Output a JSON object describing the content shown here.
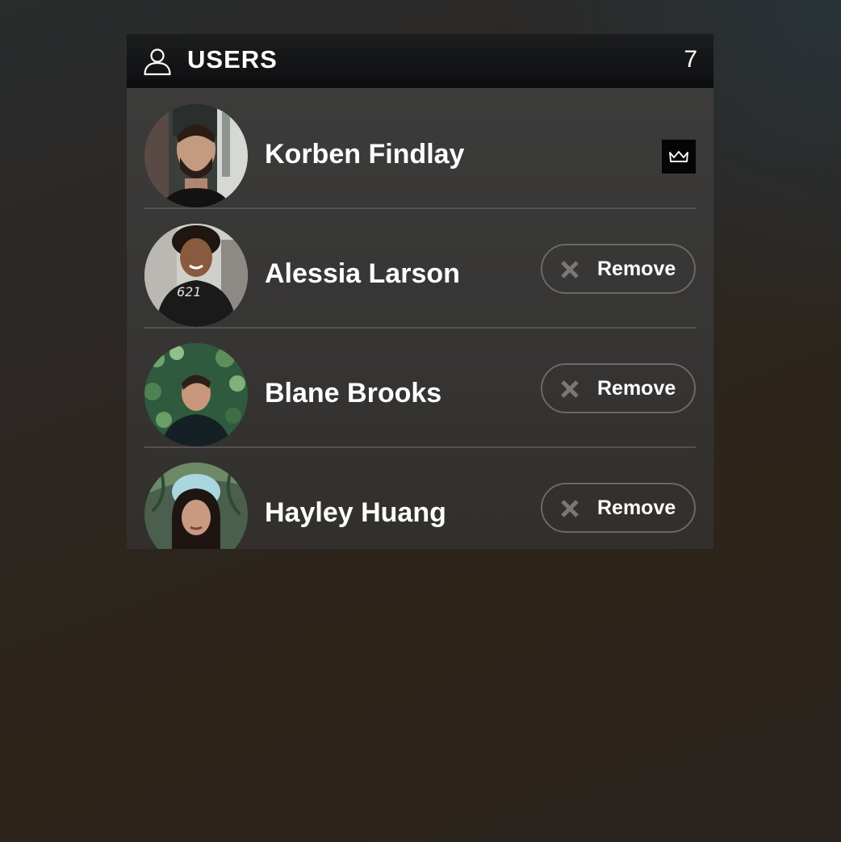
{
  "panel": {
    "title": "USERS",
    "count": "7",
    "header_icon": "user-outline-icon"
  },
  "users": [
    {
      "name": "Korben Findlay",
      "role_icon": "crown-icon"
    },
    {
      "name": "Alessia Larson",
      "action_label": "Remove",
      "action_icon": "close-icon"
    },
    {
      "name": "Blane Brooks",
      "action_label": "Remove",
      "action_icon": "close-icon"
    },
    {
      "name": "Hayley Huang",
      "action_label": "Remove",
      "action_icon": "close-icon"
    }
  ],
  "colors": {
    "header_bg": "#0d0e0f",
    "panel_bg": "#3a3938",
    "divider": "#545250",
    "button_border": "#6b6966",
    "icon_gray": "#7a7876"
  }
}
